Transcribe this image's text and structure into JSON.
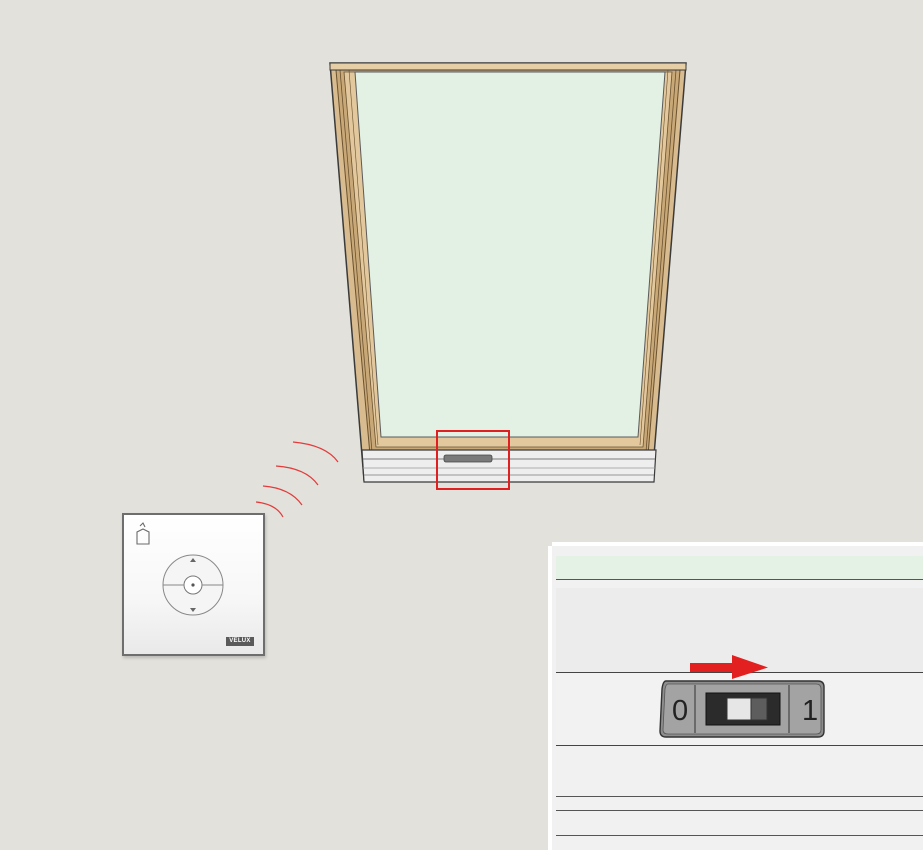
{
  "remote": {
    "brand": "VELUX"
  },
  "switch": {
    "off_label": "0",
    "on_label": "1",
    "state": "on"
  },
  "colors": {
    "wall": "#e2e1dc",
    "glass": "#e2f1e4",
    "frame_wood": "#d6b88b",
    "highlight_box": "#e02020",
    "arrow": "#e32020"
  }
}
